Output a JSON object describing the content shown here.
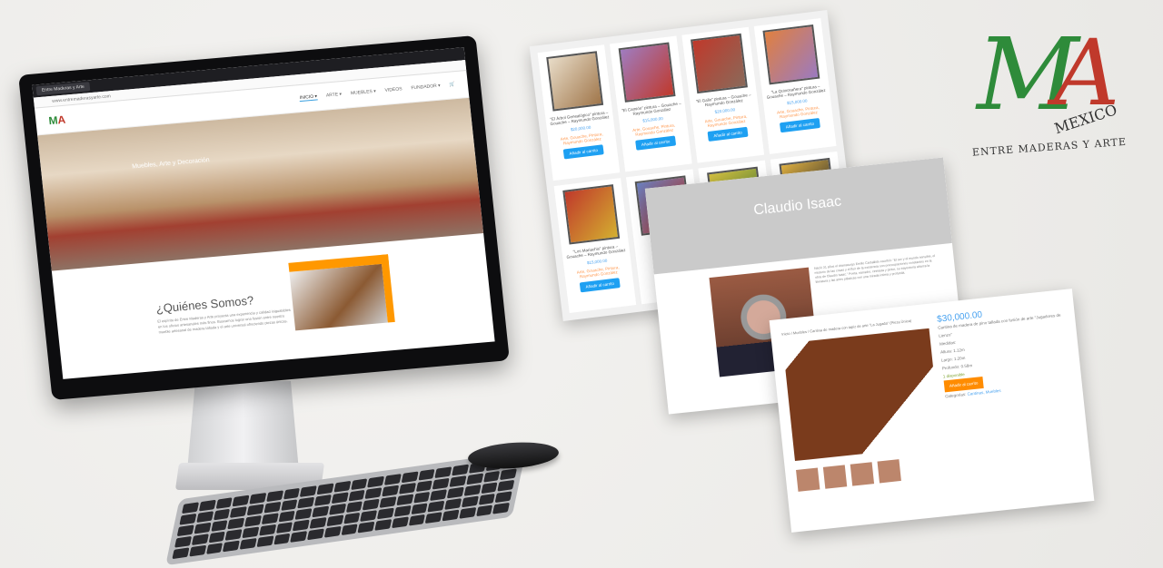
{
  "browser": {
    "tab_title": "Entre Maderas y Arte",
    "url": "www.entremaderasyarte.com"
  },
  "site": {
    "nav": [
      "INICIO ▾",
      "ARTE ▾",
      "MUEBLES ▾",
      "VIDEOS",
      "FUNDADOR ▾"
    ],
    "hero_text": "Muebles, Arte y Decoración",
    "about_title": "¿Quiénes Somos?",
    "about_text": "El espíritu de Entre Maderas y Arte proyecta una experiencia y calidad inigualables en los oficios artesanales más finos. Buscamos lograr una fusión entre nuestro mueble artesanal de madera tallada y el arte universal ofreciendo piezas únicas."
  },
  "products": [
    {
      "title": "\"El Árbol Genealógico\" pintura – Gouache – Raymundo González",
      "price": "$20,000.00",
      "colors": [
        "#e8dcc8",
        "#a0764a"
      ]
    },
    {
      "title": "\"El Camión\" pintura – Gouache – Raymundo González",
      "price": "$15,000.00",
      "colors": [
        "#9f7cc0",
        "#c0392b"
      ]
    },
    {
      "title": "\"El Gallo\" pintura – Gouache – Raymundo González",
      "price": "$20,000.00",
      "colors": [
        "#c0392b",
        "#8a6a5a"
      ]
    },
    {
      "title": "\"La Quinceañera\" pintura – Gouache – Raymundo González",
      "price": "$15,000.00",
      "colors": [
        "#e08040",
        "#9b7ac0"
      ]
    },
    {
      "title": "\"Los Mariachis\" pintura – Gouache – Raymundo González",
      "price": "$15,000.00",
      "colors": [
        "#c0392b",
        "#d4b030"
      ]
    },
    {
      "title": "Hijo",
      "price": "",
      "colors": [
        "#6a80c0",
        "#c0392b"
      ]
    },
    {
      "title": "",
      "price": "",
      "colors": [
        "#d4c040",
        "#5a8a3a"
      ]
    },
    {
      "title": "",
      "price": "",
      "colors": [
        "#e0b040",
        "#333"
      ]
    }
  ],
  "product_categories": "Arte, Gouache, Pintura, Raymundo González",
  "add_to_cart": "Añadir al carrito",
  "bio": {
    "name": "Claudio Isaac",
    "text": "Nació 31 años el dramaturgo Emilio Carballido escribió: “El ser y el mundo sensible, el misterio de las cosas y el fluir de la existencia son preocupaciones constantes en la obra de Claudio Isaac.” Poeta, narrador, cineasta y pintor, su trayectoria abarca la literatura y las artes plásticas con una mirada íntima y profunda."
  },
  "detail": {
    "breadcrumb": "Inicio / Muebles / Cantina de madera con tapiz de arte \"La Jugada\" (Pieza Única)",
    "price": "$30,000.00",
    "description": "Cantina de madera de pino tallada con fusión de arte \"Jugadores de Lienzo\"",
    "measures_label": "Medidas:",
    "height": "Altura: 1.12m",
    "length": "Largo: 1.20m",
    "depth": "Profundo: 0.58m",
    "stock": "1 disponible",
    "categories_label": "Categorías:",
    "categories": "Cantinas, Muebles"
  },
  "logo": {
    "letters": "MA",
    "country": "MEXICO",
    "tagline": "ENTRE MADERAS Y ARTE",
    "green": "#2e8b3a",
    "red": "#c0392b"
  }
}
